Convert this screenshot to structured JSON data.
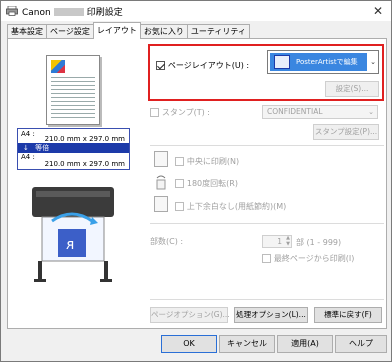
{
  "window": {
    "title_prefix": "Canon",
    "title_suffix": "印刷設定",
    "close_glyph": "✕"
  },
  "tabs": [
    {
      "label": "基本設定",
      "active": false
    },
    {
      "label": "ページ設定",
      "active": false
    },
    {
      "label": "レイアウト",
      "active": true
    },
    {
      "label": "お気に入り",
      "active": false
    },
    {
      "label": "ユーティリティ",
      "active": false
    }
  ],
  "preview": {
    "row1_label": "A4 :",
    "row1_value": "210.0 mm x 297.0 mm",
    "scale_label": "等倍",
    "scale_arrow": "↓",
    "row2_label": "A4 :",
    "row2_value": "210.0 mm x 297.0 mm"
  },
  "page_layout": {
    "checkbox_label": "ページレイアウト(U) :",
    "checked": true,
    "selected_option": "PosterArtistで編集",
    "dropdown_glyph": "⌄",
    "settings_button": "設定(S)..."
  },
  "stamp": {
    "checkbox_label": "スタンプ(T) :",
    "selected": "CONFIDENTIAL",
    "settings_button": "スタンプ設定(P)..."
  },
  "options": {
    "center_print": "中央に印刷(N)",
    "rotate_180": "180度回転(R)",
    "no_margin": "上下余白なし(用紙節約)(M)"
  },
  "copies": {
    "label": "部数(C) :",
    "value": "1",
    "range": "部 (1 - 999)",
    "last_page_first": "最終ページから印刷(I)"
  },
  "bottom_buttons": {
    "page_options": "ページオプション(G)...",
    "process_options": "処理オプション(L)...",
    "restore_defaults": "標準に戻す(F)"
  },
  "footer": {
    "ok": "OK",
    "cancel": "キャンセル",
    "apply": "適用(A)",
    "help": "ヘルプ"
  },
  "colors": {
    "highlight_border": "#e02020",
    "selected_blue": "#3a86e0",
    "size_bar": "#1c3aa9"
  }
}
